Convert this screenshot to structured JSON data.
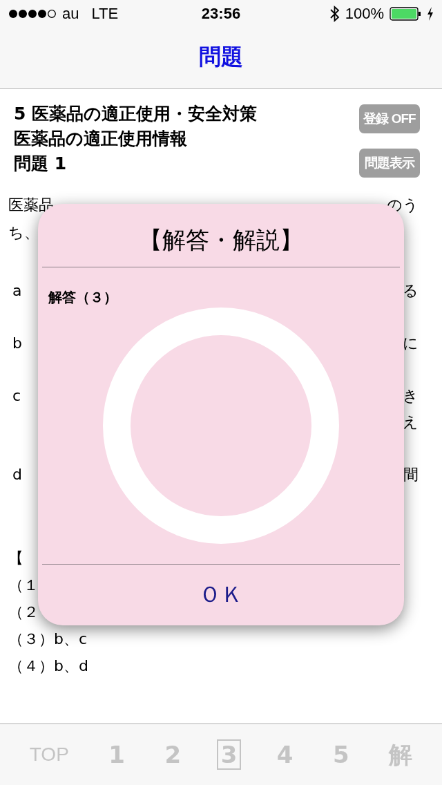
{
  "status_bar": {
    "carrier": "au",
    "network": "LTE",
    "time": "23:56",
    "battery": "100%"
  },
  "nav": {
    "title": "問題"
  },
  "header": {
    "lines": [
      "5 医薬品の適正使用・安全対策",
      "医薬品の適正使用情報",
      "問題 1"
    ],
    "buttons": [
      "登録 OFF",
      "問題表示"
    ]
  },
  "question": {
    "intro": [
      {
        "left": "医薬品",
        "right": "のう"
      },
      {
        "left": "ち、"
      }
    ],
    "items": [
      {
        "marker": "a",
        "right": [
          "る"
        ]
      },
      {
        "marker": "b",
        "right": [
          "に"
        ]
      },
      {
        "marker": "c",
        "right": [
          "き",
          "え"
        ]
      },
      {
        "marker": "d",
        "right": [
          "間"
        ]
      }
    ],
    "choices": [
      "【",
      "（１",
      "（２",
      "（３）b、c",
      "（４）b、d"
    ]
  },
  "dialog": {
    "title": "【解答・解説】",
    "answer": "解答（３）",
    "ok": "ＯＫ"
  },
  "tab_bar": [
    {
      "label": "TOP",
      "selected": false
    },
    {
      "label": "1",
      "selected": false
    },
    {
      "label": "2",
      "selected": false
    },
    {
      "label": "3",
      "selected": true
    },
    {
      "label": "4",
      "selected": false
    },
    {
      "label": "5",
      "selected": false
    },
    {
      "label": "解",
      "selected": false
    }
  ]
}
